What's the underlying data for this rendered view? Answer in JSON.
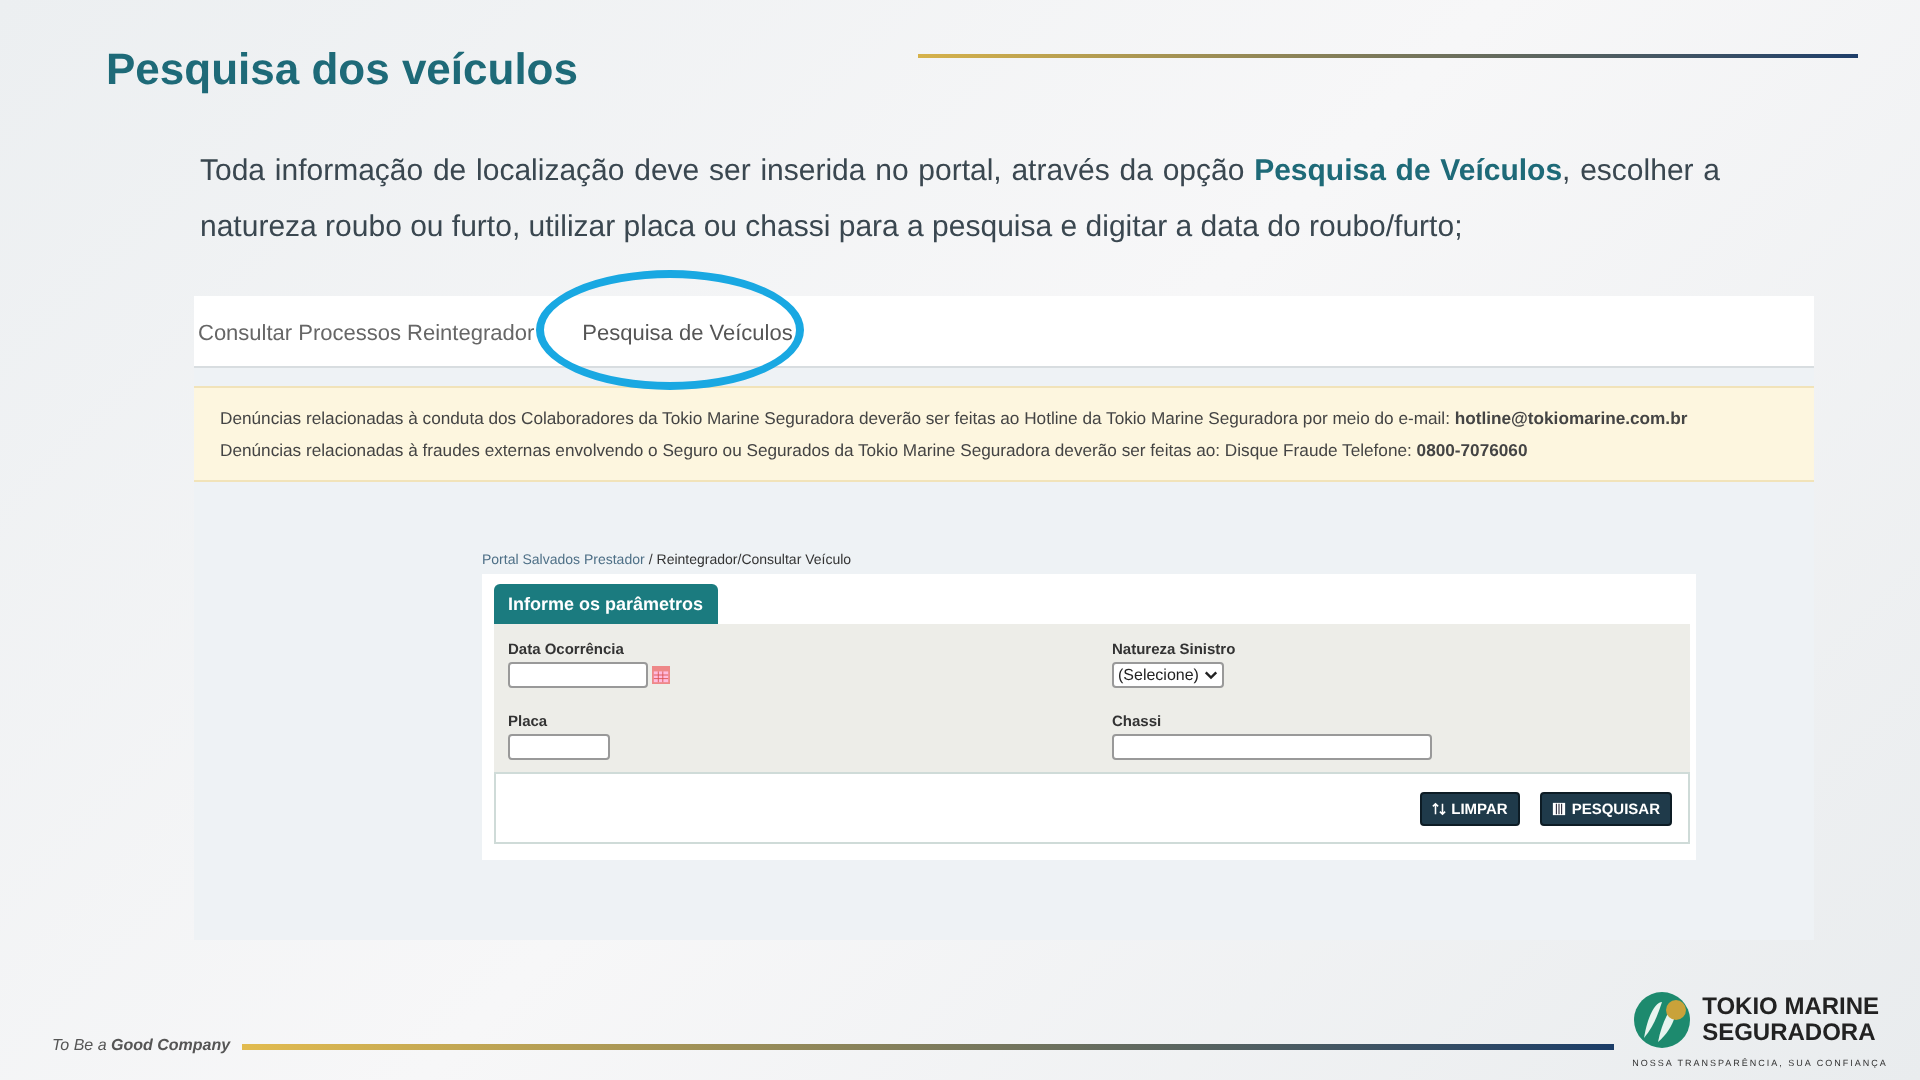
{
  "slide": {
    "title": "Pesquisa dos veículos",
    "body": "Toda informação de localização deve ser inserida no portal, através da opção **Pesquisa de Veículos**, escolher a natureza roubo ou furto, utilizar placa ou chassi para a pesquisa e digitar a data do roubo/furto;"
  },
  "portal": {
    "tabs": [
      {
        "label": "Consultar Processos Reintegrador",
        "selected": false
      },
      {
        "label": "Pesquisa de Veículos",
        "selected": true
      }
    ],
    "notices": [
      "Denúncias relacionadas à conduta dos Colaboradores da Tokio Marine Seguradora deverão ser feitas ao Hotline da Tokio Marine Seguradora por meio do e-mail: **hotline@tokiomarine.com.br**",
      "Denúncias relacionadas à fraudes externas envolvendo o Seguro ou Segurados da Tokio Marine Seguradora deverão ser feitas ao: Disque Fraude Telefone: **0800-7076060**"
    ],
    "breadcrumb": {
      "link": "Portal Salvados Prestador",
      "separator": "/",
      "current": "Reintegrador/Consultar Veículo"
    },
    "form": {
      "title": "Informe os parâmetros",
      "fields": [
        {
          "kind": "date",
          "label": "Data Ocorrência"
        },
        {
          "kind": "select",
          "label": "Natureza Sinistro",
          "value": "(Selecione)"
        },
        {
          "kind": "short",
          "label": "Placa"
        },
        {
          "kind": "long",
          "label": "Chassi"
        }
      ],
      "buttons": [
        {
          "kind": "clear",
          "label": "LIMPAR"
        },
        {
          "kind": "search",
          "label": "PESQUISAR"
        }
      ]
    }
  },
  "footer": {
    "tagline": "To Be a **Good Company**",
    "logo_name": "TOKIO MARINE",
    "logo_sub": "SEGURADORA",
    "motto": "NOSSA TRANSPARÊNCIA, SUA CONFIANÇA"
  }
}
